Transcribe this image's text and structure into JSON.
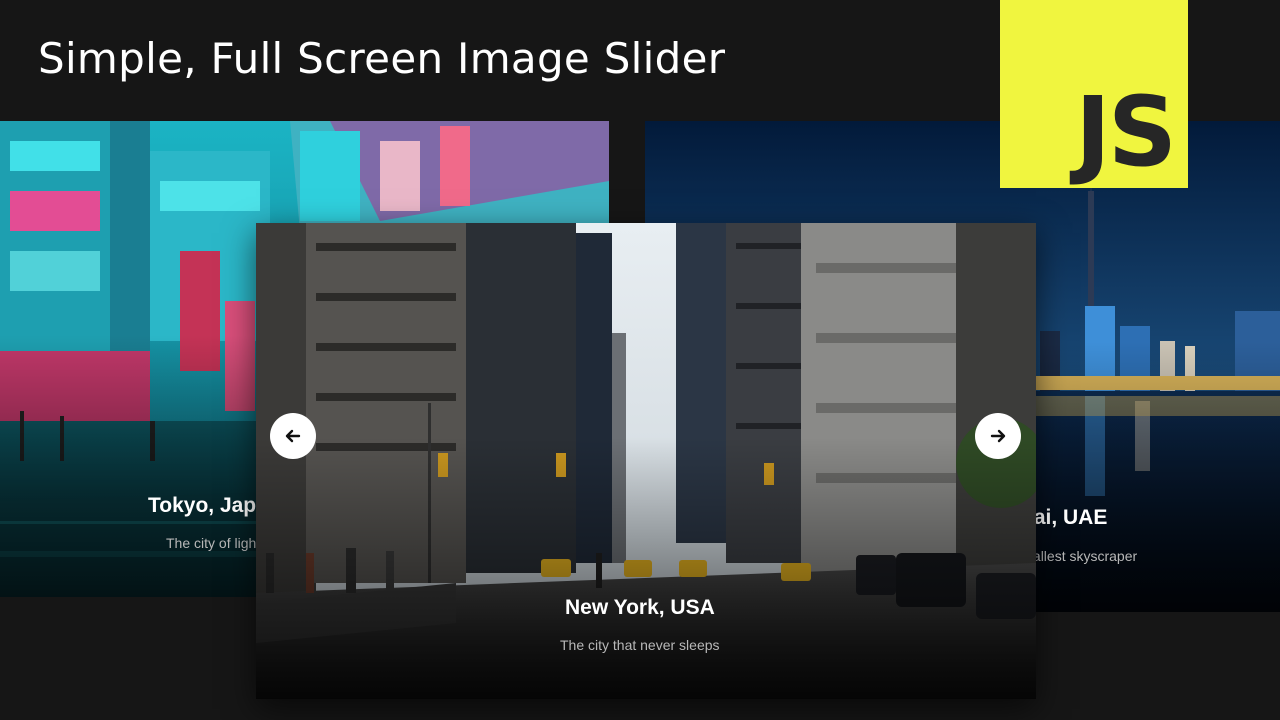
{
  "header": {
    "title": "Simple, Full Screen Image Slider"
  },
  "badge": {
    "label": "JS",
    "color": "#f0f53f"
  },
  "slides": [
    {
      "title": "Tokyo, Japan",
      "subtitle": "The city of lights"
    },
    {
      "title": "New York, USA",
      "subtitle": "The city that never sleeps"
    },
    {
      "title": "Dubai, UAE",
      "subtitle": "The tallest skyscraper"
    }
  ],
  "controls": {
    "prev_icon": "arrow-left-icon",
    "next_icon": "arrow-right-icon"
  },
  "colors": {
    "background": "#161616",
    "nav_button": "#ffffff"
  }
}
